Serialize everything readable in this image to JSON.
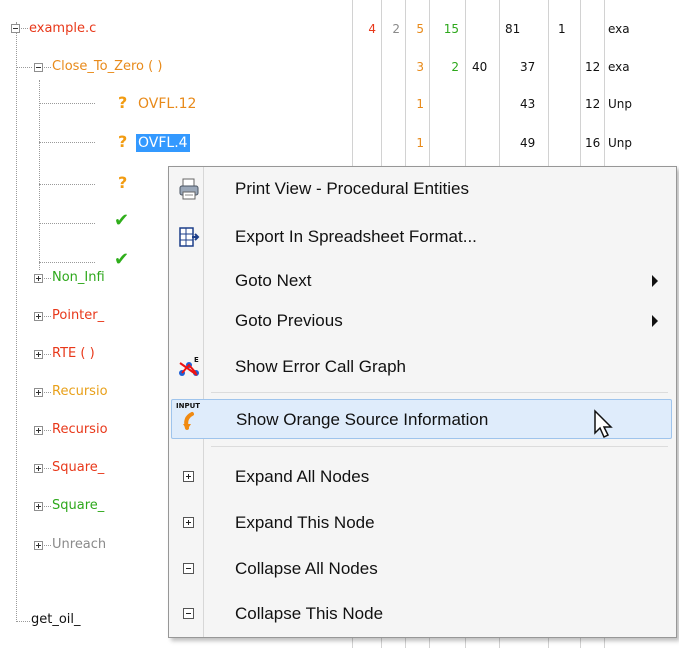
{
  "tree": {
    "root": {
      "label": "example.c",
      "color": "#e8381a",
      "cells": [
        "4",
        "2",
        "5",
        "15",
        "81",
        "1",
        "",
        "exa"
      ]
    },
    "child": {
      "label": "Close_To_Zero ( )",
      "color": "#e88a1a",
      "cells": [
        "",
        "",
        "3",
        "2",
        "40",
        "37",
        "12",
        "exa"
      ]
    },
    "leaves": [
      {
        "label": "OVFL.12",
        "status": "orange",
        "cells": [
          "1",
          "",
          "",
          "43",
          "12",
          "Unp"
        ]
      },
      {
        "label": "OVFL.4",
        "status": "orange",
        "selected": true,
        "cells": [
          "1",
          "",
          "",
          "49",
          "16",
          "Unp"
        ]
      },
      {
        "label": "",
        "status": "orange"
      },
      {
        "label": "",
        "status": "green"
      },
      {
        "label": "",
        "status": "green"
      }
    ],
    "siblings": [
      {
        "label": "Non_Infi",
        "color": "#2ea81c"
      },
      {
        "label": "Pointer_",
        "color": "#e8381a"
      },
      {
        "label": "RTE ( )",
        "color": "#e8381a"
      },
      {
        "label": "Recursio",
        "color": "#e8a01a"
      },
      {
        "label": "Recursio",
        "color": "#e8381a"
      },
      {
        "label": "Square_",
        "color": "#e8381a"
      },
      {
        "label": "Square_",
        "color": "#2ea81c"
      },
      {
        "label": "Unreach",
        "color": "#8a8a8a"
      },
      {
        "label": "get_oil_",
        "color": "#111111"
      }
    ],
    "cell_colors": [
      "#e8381a",
      "#8a8a8a",
      "#e88a1a",
      "#2ea81c",
      "#111111",
      "#111111",
      "#111111",
      "#111111"
    ]
  },
  "menu": {
    "items": [
      {
        "label": "Print View - Procedural Entities",
        "icon": "printer-icon"
      },
      {
        "label": "Export In Spreadsheet Format...",
        "icon": "spreadsheet-export-icon"
      },
      {
        "label": "Goto Next",
        "submenu": true
      },
      {
        "label": "Goto Previous",
        "submenu": true
      },
      {
        "label": "Show Error Call Graph",
        "icon": "call-graph-icon"
      },
      {
        "label": "Show Orange Source Information",
        "icon": "input-source-icon",
        "icon_text": "INPUT",
        "highlighted": true
      },
      {
        "label": "Expand All Nodes",
        "icon": "expand-icon"
      },
      {
        "label": "Expand This Node",
        "icon": "expand-icon"
      },
      {
        "label": "Collapse All Nodes",
        "icon": "collapse-icon"
      },
      {
        "label": "Collapse This Node",
        "icon": "collapse-icon"
      }
    ],
    "highlight_color": "#dfecfb"
  }
}
